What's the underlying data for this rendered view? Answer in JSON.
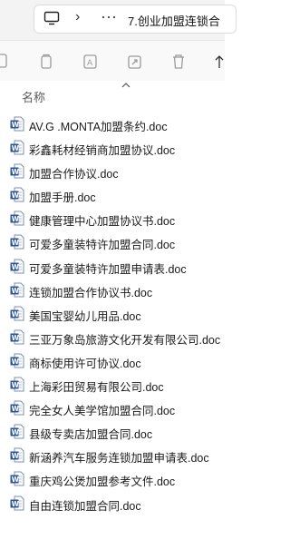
{
  "address_bar": {
    "monitor_icon": "monitor-icon",
    "separator_icon": "chevron-right-icon",
    "more_icon": "more-icon",
    "path_text": "7.创业加盟连锁合"
  },
  "toolbar": {
    "icons": [
      "new-icon",
      "copy-icon",
      "paste-icon",
      "rename-icon",
      "share-icon",
      "delete-icon",
      "sort-icon"
    ]
  },
  "column_header": {
    "name": "名称"
  },
  "files": [
    "AV.G .MONTA加盟条约.doc",
    "彩鑫耗材经销商加盟协议.doc",
    "加盟合作协议.doc",
    "加盟手册.doc",
    "健康管理中心加盟协议书.doc",
    "可爱多童装特许加盟合同.doc",
    "可爱多童装特许加盟申请表.doc",
    "连锁加盟合作协议书.doc",
    "美国宝婴幼儿用品.doc",
    "三亚万象岛旅游文化开发有限公司.doc",
    "商标使用许可协议.doc",
    "上海彩田贸易有限公司.doc",
    "完全女人美学馆加盟合同.doc",
    "县级专卖店加盟合同.doc",
    "新涵养汽车服务连锁加盟申请表.doc",
    "重庆鸡公煲加盟参考文件.doc",
    "自由连锁加盟合同.doc"
  ],
  "colors": {
    "word_blue": "#2b579a",
    "toolbar_icon": "#9a9a9a"
  }
}
